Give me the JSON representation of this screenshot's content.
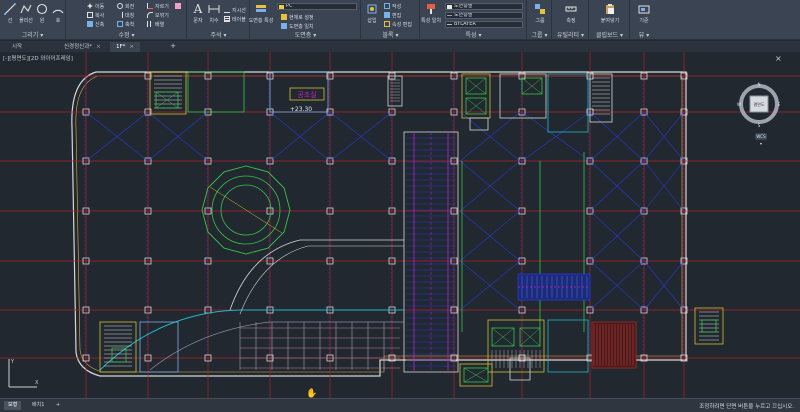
{
  "colors": {
    "background": "#212830",
    "ribbon": "#3b4453",
    "grid_red": "#b0202a",
    "wall_white": "#d6d6d6",
    "blue": "#2a3ad0",
    "magenta": "#c020c0",
    "green": "#39c24a",
    "yellow": "#d0c030",
    "cyan": "#20b8c8"
  },
  "ribbon": {
    "panels": [
      {
        "id": "draw",
        "title": "그리기 ▾",
        "buttons": [
          "선",
          "폴리선",
          "원",
          "호"
        ]
      },
      {
        "id": "modify",
        "title": "수정 ▾",
        "buttons": [
          "이동",
          "회전",
          "자르기",
          "복사",
          "대칭",
          "모깎기",
          "신축",
          "축척",
          "배열"
        ]
      },
      {
        "id": "annotation",
        "title": "주석 ▾",
        "buttons": [
          "문자",
          "치수",
          "지시선",
          "테이블"
        ]
      },
      {
        "id": "layers",
        "title": "도면층 ▾",
        "buttons": [
          "도면층 특성",
          "현재로 설정",
          "도면층 일치"
        ],
        "layer_value": "PC"
      },
      {
        "id": "block",
        "title": "블록 ▾",
        "buttons": [
          "삽입",
          "작성",
          "편집",
          "속성 편집"
        ]
      },
      {
        "id": "properties",
        "title": "특성 ▾",
        "buttons": [
          "특성 일치"
        ],
        "color_value": "도면층별",
        "linetype_value": "도면층별",
        "lineweight_value": "BYLAYER"
      },
      {
        "id": "groups",
        "title": "그룹 ▾",
        "buttons": [
          "그룹"
        ]
      },
      {
        "id": "utilities",
        "title": "유틸리티 ▾",
        "buttons": [
          "측정"
        ]
      },
      {
        "id": "clipboard",
        "title": "클립보드 ▾",
        "buttons": [
          "붙여넣기"
        ]
      },
      {
        "id": "view",
        "title": "뷰 ▾",
        "buttons": [
          "기준"
        ]
      }
    ],
    "extra_labels": {
      "room_title": "공조실",
      "room_text": "+23.30"
    }
  },
  "tabs": [
    {
      "label": "시작",
      "active": false
    },
    {
      "label": "신경정신과*",
      "active": false
    },
    {
      "label": "1F*",
      "active": true
    }
  ],
  "viewport_label": "[-][평면도][2D 와이어프레임]",
  "viewcube": {
    "face_label": "평면도",
    "nav_label": "WCS ▾"
  },
  "status": {
    "layout_tabs": [
      "모형",
      "배치1"
    ],
    "message": "조정하려면 단면 버튼을 누르고 끄십시오."
  },
  "drawing": {
    "grid_columns": 14,
    "grid_rows": 6,
    "room_label": "공조실",
    "room_elevation": "+23.30"
  }
}
